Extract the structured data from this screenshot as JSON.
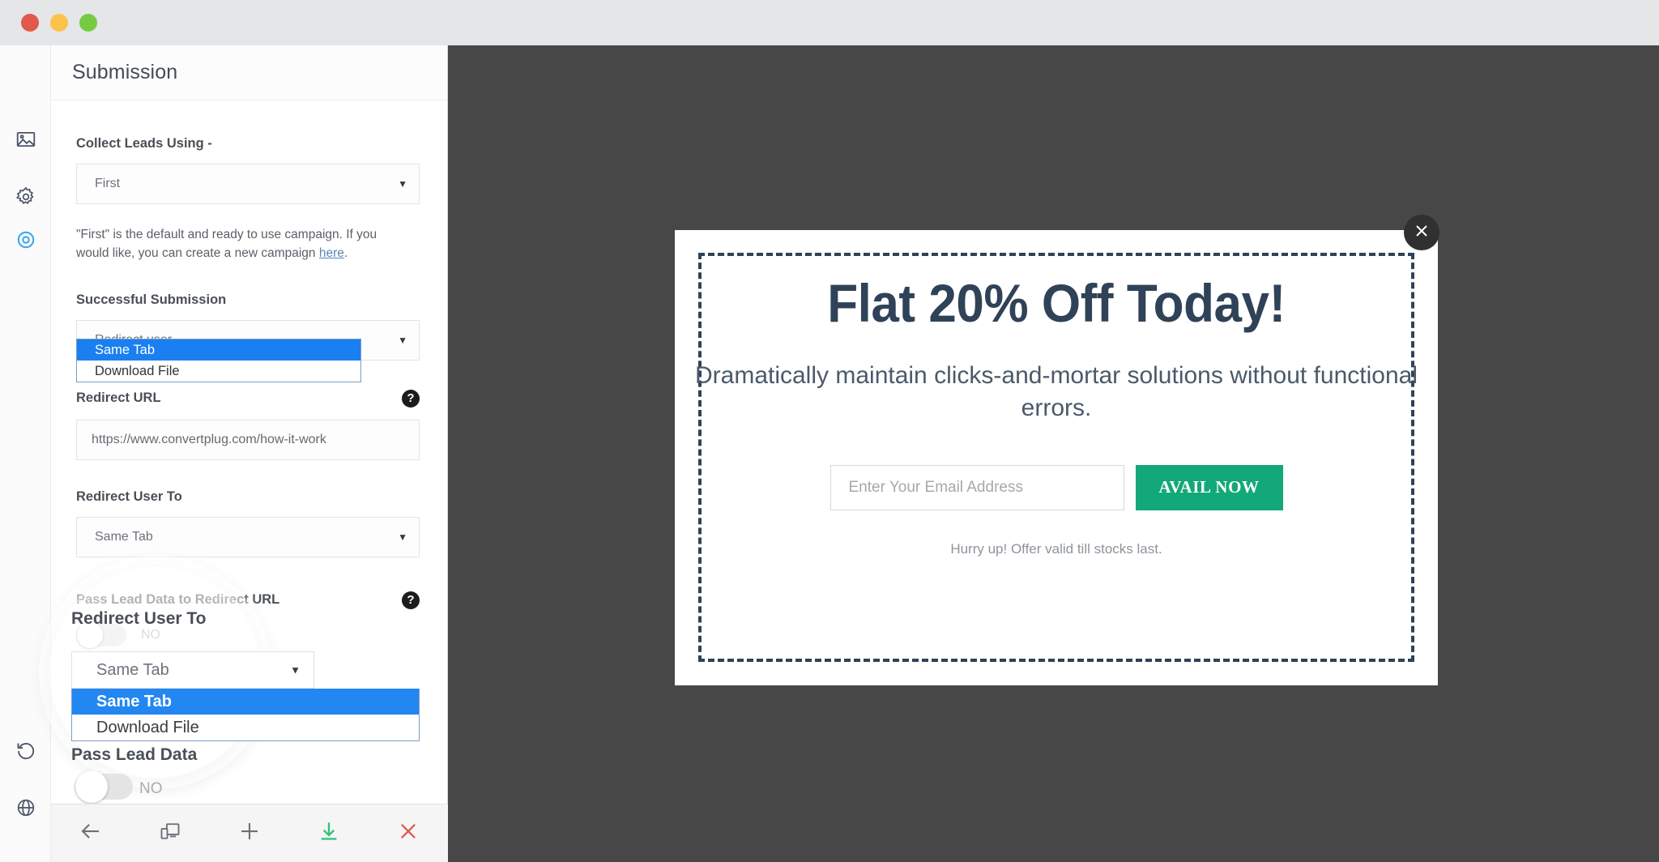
{
  "window": {
    "dots": [
      "close-red",
      "minimize-yellow",
      "maximize-green"
    ]
  },
  "rail": {
    "items": [
      {
        "icon": "image-icon",
        "active": false
      },
      {
        "icon": "gear-icon",
        "active": false
      },
      {
        "icon": "target-icon",
        "active": true
      },
      {
        "icon": "history-undo-icon",
        "active": false
      },
      {
        "icon": "globe-icon",
        "active": false
      }
    ]
  },
  "panel": {
    "title": "Submission",
    "collect_leads": {
      "label": "Collect Leads Using -",
      "value": "First",
      "caret": "▼"
    },
    "help_text": {
      "before": "\"First\" is the default and ready to use campaign. If you would like, you can create a new campaign ",
      "link": "here",
      "after": "."
    },
    "successful_submission": {
      "label": "Successful Submission",
      "value": "Redirect user",
      "caret": "▼"
    },
    "redirect_url": {
      "label": "Redirect URL",
      "help_badge": "?",
      "value": "https://www.convertplug.com/how-it-work"
    },
    "redirect_user_to": {
      "label": "Redirect User To",
      "value": "Same Tab",
      "caret": "▼",
      "options": [
        "Same Tab",
        "Download File"
      ],
      "selected_index": 0
    },
    "pass_lead_data": {
      "label": "Pass Lead Data to Redirect URL",
      "help_badge": "?",
      "toggle_state": "NO"
    }
  },
  "toolbar": {
    "buttons": [
      {
        "name": "back-arrow-icon",
        "label": "Back"
      },
      {
        "name": "responsive-device-icon",
        "label": "Responsive"
      },
      {
        "name": "plus-icon",
        "label": "Add"
      },
      {
        "name": "save-download-icon",
        "label": "Save"
      },
      {
        "name": "close-x-icon",
        "label": "Close"
      }
    ]
  },
  "preview": {
    "background_color": "#474747",
    "popup": {
      "close_label": "×",
      "headline": "Flat 20% Off Today!",
      "subheadline": "Dramatically maintain clicks-and-mortar solutions without functional errors.",
      "email_placeholder": "Enter Your Email Address",
      "email_value": "",
      "cta_label": "AVAIL NOW",
      "note": "Hurry up! Offer valid till stocks last.",
      "accent_color": "#12a877",
      "text_color": "#2f4257"
    }
  }
}
